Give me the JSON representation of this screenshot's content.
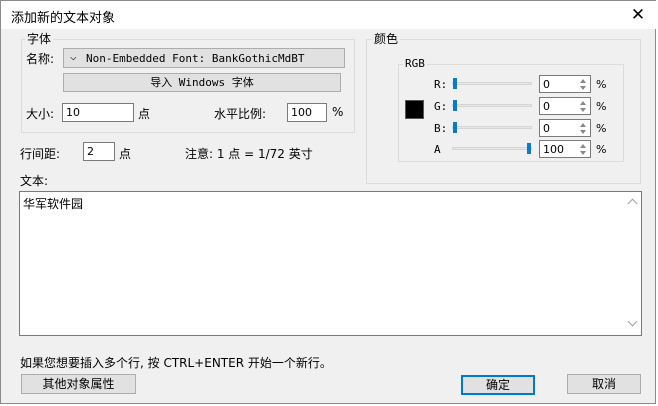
{
  "window": {
    "title": "添加新的文本对象",
    "close_glyph": "✕"
  },
  "font_group": {
    "label": "字体",
    "name_label": "名称:",
    "font_dropdown_value": "Non-Embedded Font: BankGothicMdBT",
    "import_button": "导入 Windows 字体",
    "size_label": "大小:",
    "size_value": "10",
    "size_unit": "点",
    "hscale_label": "水平比例:",
    "hscale_value": "100",
    "hscale_unit": "%"
  },
  "line_spacing": {
    "label": "行间距:",
    "value": "2",
    "unit": "点"
  },
  "note": "注意: 1 点 = 1/72 英寸",
  "color_group": {
    "label": "颜色",
    "rgb_label": "RGB",
    "swatch_color": "#000000",
    "channels": [
      {
        "label": "R:",
        "value": "0",
        "unit": "%",
        "level": 0
      },
      {
        "label": "G:",
        "value": "0",
        "unit": "%",
        "level": 0
      },
      {
        "label": "B:",
        "value": "0",
        "unit": "%",
        "level": 0
      },
      {
        "label": "A",
        "value": "100",
        "unit": "%",
        "level": 100
      }
    ]
  },
  "text_section": {
    "label": "文本:",
    "content": "华军软件园"
  },
  "hint": "如果您想要插入多个行, 按 CTRL+ENTER 开始一个新行。",
  "buttons": {
    "other_props": "其他对象属性",
    "ok": "确定",
    "cancel": "取消"
  },
  "colors": {
    "accent": "#0078d7",
    "slider_thumb": "#0a7ad1"
  }
}
